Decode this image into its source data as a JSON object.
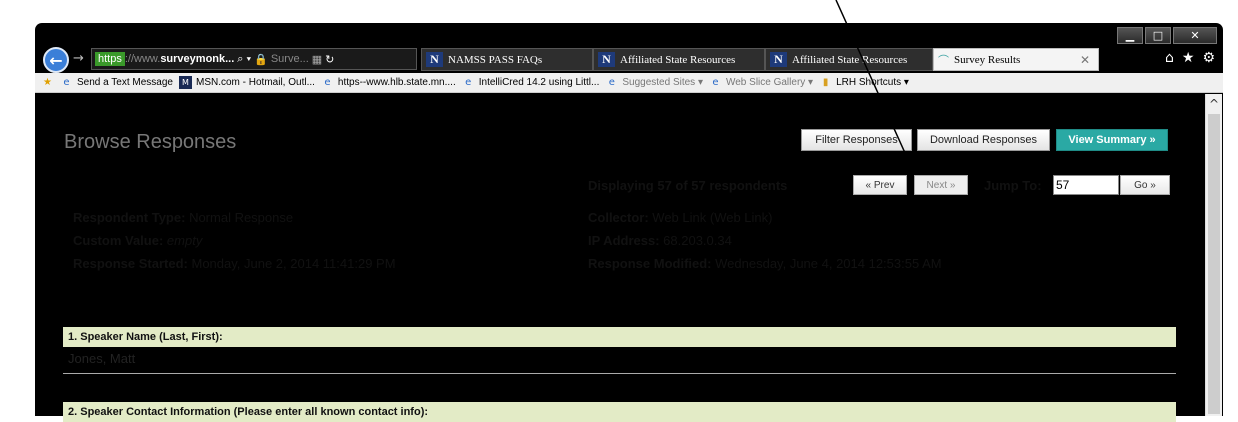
{
  "window": {
    "controls": {
      "min": "▁",
      "max": "□",
      "close": "✕"
    }
  },
  "tabbar": {
    "address": {
      "prefix": "https",
      "dim": "://www.",
      "host": "surveymonk...",
      "suffix": "Surve..."
    },
    "tabs": [
      {
        "label": "NAMSS PASS FAQs",
        "icon": "N"
      },
      {
        "label": "Affiliated State Resources",
        "icon": "N"
      },
      {
        "label": "Affiliated State Resources",
        "icon": "N"
      },
      {
        "label": "Survey Results",
        "icon": "surveymonkey-icon",
        "active": true
      }
    ],
    "close": "✕"
  },
  "favorites": [
    {
      "label": "Send a Text Message",
      "icon": "ie"
    },
    {
      "label": "MSN.com - Hotmail, Outl...",
      "icon": "msn"
    },
    {
      "label": "https--www.hlb.state.mn....",
      "icon": "ie"
    },
    {
      "label": "IntelliCred 14.2 using Littl...",
      "icon": "ie"
    },
    {
      "label": "Suggested Sites ▾",
      "icon": "ie",
      "dim": true
    },
    {
      "label": "Web Slice Gallery ▾",
      "icon": "ie",
      "dim": true
    },
    {
      "label": "LRH Shortcuts ▾",
      "icon": "folder"
    }
  ],
  "page": {
    "title": "Browse Responses",
    "buttons": {
      "filter": "Filter Responses",
      "download": "Download Responses",
      "summary": "View Summary »"
    },
    "pager": {
      "displaying": "Displaying 57 of 57 respondents",
      "prev": "« Prev",
      "next": "Next »",
      "jump_label": "Jump To:",
      "jump_value": "57",
      "go": "Go »"
    },
    "meta": {
      "respondent_type_label": "Respondent Type:",
      "respondent_type_value": "Normal Response",
      "custom_value_label": "Custom Value:",
      "custom_value_value": "empty",
      "response_started_label": "Response Started:",
      "response_started_value": "Monday, June 2, 2014 11:41:29 PM",
      "collector_label": "Collector:",
      "collector_value": "Web Link (Web Link)",
      "ip_label": "IP Address:",
      "ip_value": "68.203.0.34",
      "modified_label": "Response Modified:",
      "modified_value": "Wednesday, June 4, 2014 12:53:55 AM"
    },
    "questions": [
      {
        "q": "1. Speaker Name (Last, First):",
        "a": "Jones, Matt"
      },
      {
        "q": "2. Speaker Contact Information (Please enter all known contact info):",
        "a": ""
      }
    ]
  }
}
